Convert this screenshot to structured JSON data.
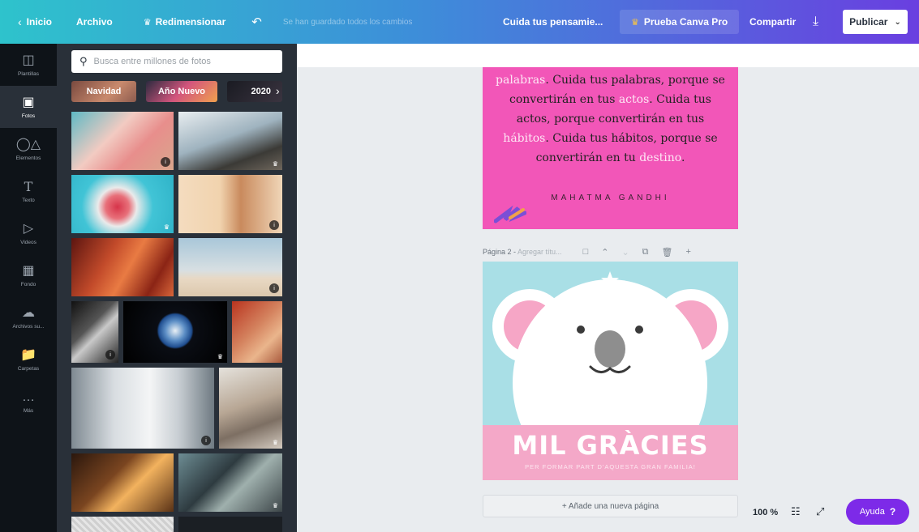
{
  "topbar": {
    "home": "Inicio",
    "file": "Archivo",
    "resize": "Redimensionar",
    "saved_status": "Se han guardado todos los cambios",
    "design_title": "Cuida tus pensamie...",
    "pro_trial": "Prueba Canva Pro",
    "share": "Compartir",
    "publish": "Publicar"
  },
  "rail": {
    "items": [
      {
        "label": "Plantillas",
        "icon": "templates-icon"
      },
      {
        "label": "Fotos",
        "icon": "photos-icon"
      },
      {
        "label": "Elementos",
        "icon": "elements-icon"
      },
      {
        "label": "Texto",
        "icon": "text-icon"
      },
      {
        "label": "Videos",
        "icon": "videos-icon"
      },
      {
        "label": "Fondo",
        "icon": "background-icon"
      },
      {
        "label": "Archivos su...",
        "icon": "uploads-icon"
      },
      {
        "label": "Carpetas",
        "icon": "folders-icon"
      },
      {
        "label": "Más",
        "icon": "more-icon"
      }
    ],
    "active_index": 1
  },
  "panel": {
    "search_placeholder": "Busca entre millones de fotos",
    "chips": [
      "Navidad",
      "Año Nuevo",
      "2020"
    ]
  },
  "canvas": {
    "page1": {
      "quote_segments": [
        {
          "text": "palabras",
          "highlight": true
        },
        {
          "text": ". Cuida tus palabras, porque se convertirán en tus ",
          "highlight": false
        },
        {
          "text": "actos",
          "highlight": true
        },
        {
          "text": ". Cuida tus actos, porque convertirán en tus ",
          "highlight": false
        },
        {
          "text": "hábitos",
          "highlight": true
        },
        {
          "text": ". Cuida tus hábitos, porque se convertirán en tu ",
          "highlight": false
        },
        {
          "text": "destino",
          "highlight": true
        },
        {
          "text": ".",
          "highlight": false
        }
      ],
      "author": "MAHATMA GANDHI"
    },
    "page2_toolbar": {
      "label": "Página 2 -",
      "title_placeholder": "Agregar títu..."
    },
    "page2": {
      "title": "MIL GRÀCIES",
      "subtitle": "PER FORMAR PART D'AQUESTA GRAN FAMILIA!"
    },
    "add_page": "+ Añade una nueva página"
  },
  "footer": {
    "zoom": "100 %",
    "help": "Ayuda",
    "help_mark": "?"
  },
  "colors": {
    "accent_purple": "#7d2ae8",
    "topbar_start": "#2ec3cc",
    "topbar_end": "#6a3fe0",
    "page1_bg": "#f256b8",
    "page2_bg": "#a9dfe6",
    "page2_band": "#f4a8c8"
  }
}
